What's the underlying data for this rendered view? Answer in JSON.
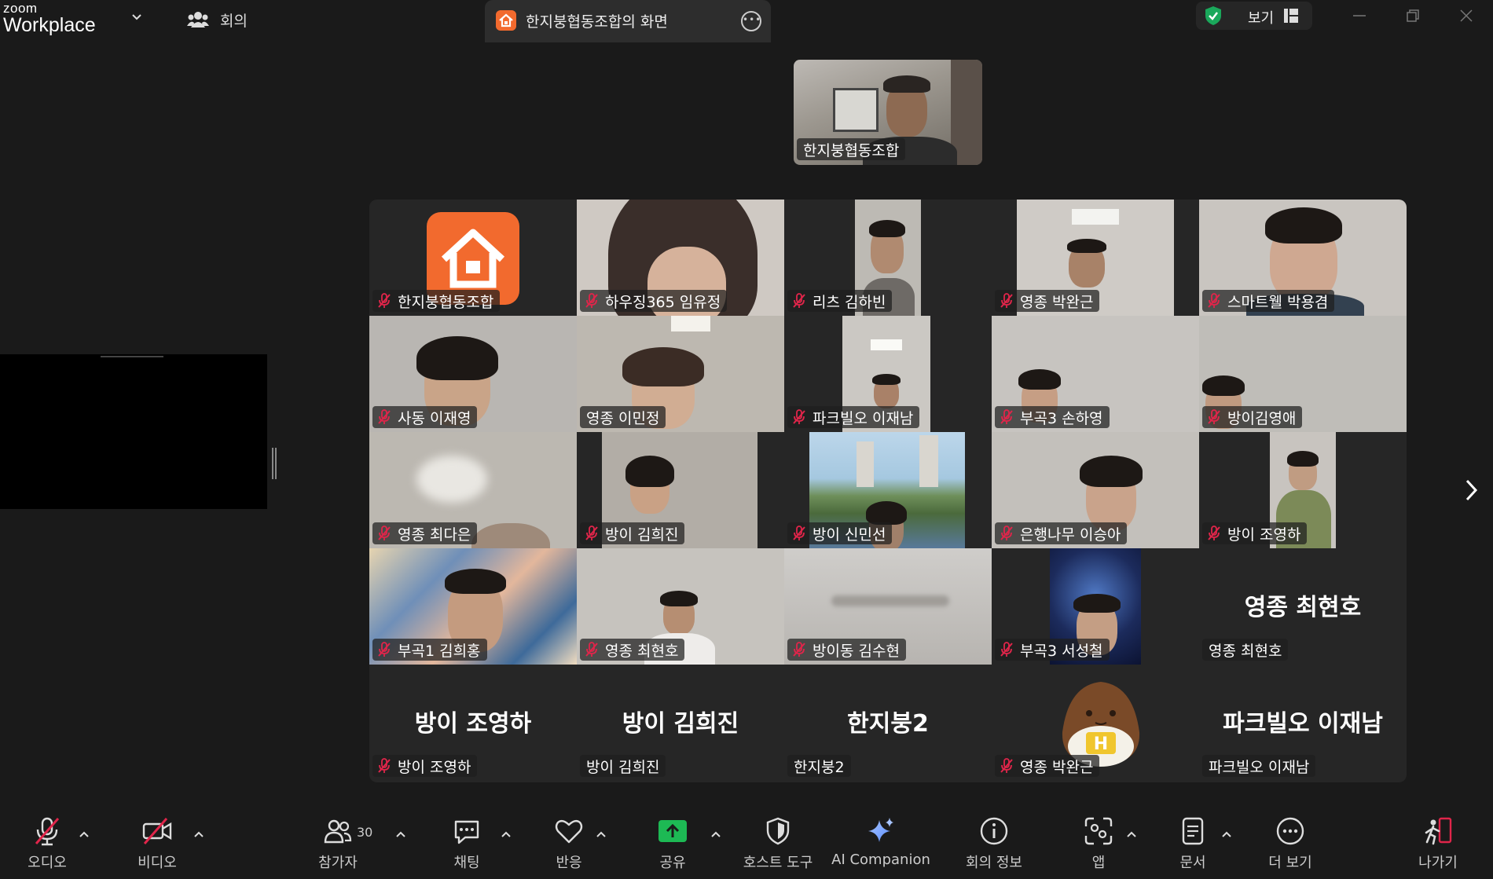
{
  "titlebar": {
    "brand_top": "zoom",
    "brand_bottom": "Workplace",
    "meeting_tab": "회의",
    "share_tab_title": "한지붕협동조합의 화면",
    "view_label": "보기"
  },
  "presenter": {
    "name": "한지붕협동조합"
  },
  "gallery": {
    "tiles": [
      {
        "name": "한지붕협동조합"
      },
      {
        "name": "하우징365 임유정"
      },
      {
        "name": "리츠 김하빈"
      },
      {
        "name": "영종 박완근"
      },
      {
        "name": "스마트웰 박용겸"
      },
      {
        "name": "사동 이재영"
      },
      {
        "name": "영종 이민정"
      },
      {
        "name": "파크빌오 이재남"
      },
      {
        "name": "부곡3 손하영"
      },
      {
        "name": "방이김영애"
      },
      {
        "name": "영종 최다은"
      },
      {
        "name": "방이 김희진"
      },
      {
        "name": "방이 신민선"
      },
      {
        "name": "은행나무 이승아"
      },
      {
        "name": "방이 조영하"
      },
      {
        "name": "부곡1 김희홍"
      },
      {
        "name": "영종 최현호"
      },
      {
        "name": "방이동 김수현"
      },
      {
        "name": "부곡3 서성철"
      },
      {
        "name": "영종 최현호",
        "big": "영종 최현호"
      },
      {
        "name": "방이 조영하",
        "big": "방이 조영하"
      },
      {
        "name": "방이 김희진",
        "big": "방이 김희진"
      },
      {
        "name": "한지붕2",
        "big": "한지붕2"
      },
      {
        "name": "영종 박완근"
      },
      {
        "name": "파크빌오 이재남",
        "big": "파크빌오 이재남"
      }
    ]
  },
  "toolbar": {
    "audio": "오디오",
    "video": "비디오",
    "participants": "참가자",
    "participants_count": "30",
    "chat": "채팅",
    "reactions": "반응",
    "share": "공유",
    "host_tools": "호스트 도구",
    "ai_companion": "AI Companion",
    "meeting_info": "회의 정보",
    "apps": "앱",
    "docs": "문서",
    "more": "더 보기",
    "leave": "나가기"
  },
  "colors": {
    "share_green": "#1db954",
    "mute_red": "#e0254a",
    "brand_orange": "#f26a2e",
    "secure_green": "#1aa85b"
  }
}
